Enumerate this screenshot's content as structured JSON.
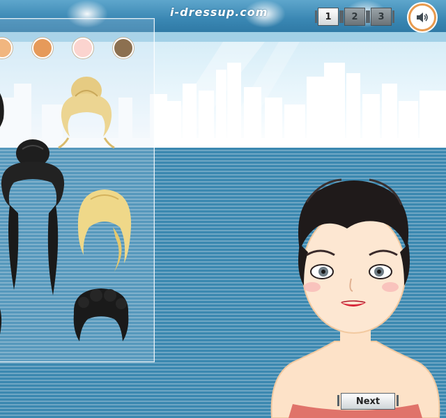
{
  "header": {
    "logo_text": "i-dressup.com",
    "page_buttons": [
      "1",
      "2",
      "3"
    ],
    "active_page": "1",
    "sound_icon": "speaker-icon"
  },
  "palette": {
    "swatches": [
      "#f1b67f",
      "#e69a5a",
      "#fbd4cf",
      "#8c7050"
    ]
  },
  "hair_options": [
    {
      "name": "blonde-updo",
      "color": "#e9d28e"
    },
    {
      "name": "black-long-pigtail-updo",
      "color": "#1c1c1c"
    },
    {
      "name": "blonde-bob",
      "color": "#efd889"
    },
    {
      "name": "black-curly-short",
      "color": "#1a1a1a"
    }
  ],
  "footer": {
    "next_label": "Next"
  },
  "colors": {
    "accent": "#e89a4e",
    "background_stripe": "#3b88b0"
  }
}
